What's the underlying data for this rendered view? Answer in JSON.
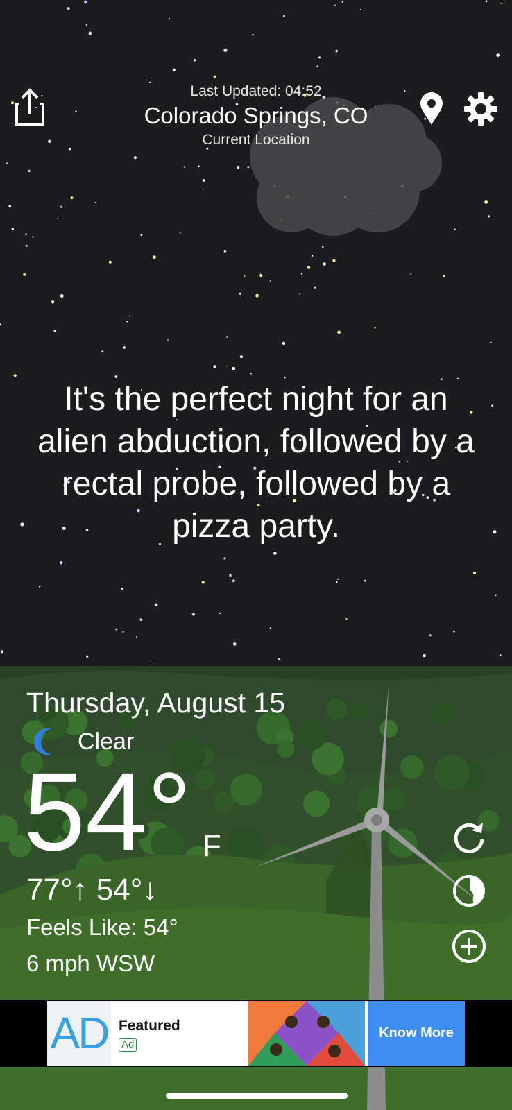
{
  "header": {
    "last_updated": "Last Updated: 04:52",
    "location": "Colorado Springs, CO",
    "location_type": "Current Location",
    "share_icon": "share-icon",
    "location_pin_icon": "location-pin-icon",
    "settings_icon": "gear-icon"
  },
  "quip": "It's the perfect night for an alien abduction, followed by a rectal probe, followed by a pizza party.",
  "weather": {
    "date": "Thursday, August 15",
    "condition_icon": "moon-icon",
    "condition": "Clear",
    "temperature": "54°",
    "unit": "F",
    "hi_lo": "77°↑ 54°↓",
    "feels_like": "Feels Like: 54°",
    "wind": "6 mph WSW"
  },
  "side_actions": {
    "refresh_icon": "refresh-icon",
    "radar_icon": "radar-icon",
    "add_icon": "add-icon"
  },
  "ad": {
    "logo_text": "AD",
    "featured": "Featured",
    "badge": "Ad",
    "cta": "Know More"
  },
  "colors": {
    "sky": "#1c1c1e",
    "hill_light": "#3d6a2b",
    "hill_dark": "#2b4f22",
    "ad_cta": "#3d8ef0"
  }
}
